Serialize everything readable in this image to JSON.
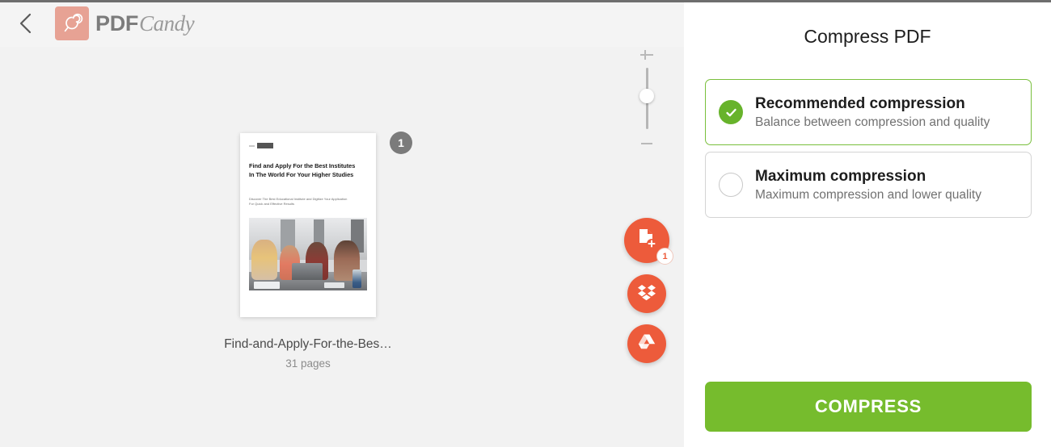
{
  "header": {
    "back_icon": "chevron-left-icon",
    "logo_icon": "lollipop-icon",
    "brand_primary": "PDF",
    "brand_secondary": "Candy",
    "brand_color": "#e7a294"
  },
  "viewer": {
    "page_badge": "1",
    "file_name": "Find-and-Apply-For-the-Bes…",
    "page_count": "31 pages",
    "document_preview": {
      "heading": "Find and Apply For the Best Institutes In The World For Your Higher Studies",
      "subheading": "Discover The Best Educational Institute and Digitize Your Application For Quick and Effective Results"
    },
    "zoom": {
      "increase_icon": "plus-icon",
      "decrease_icon": "minus-icon",
      "handle_icon": "slider-handle"
    },
    "actions": [
      {
        "name": "add-file",
        "icon": "document-plus-icon",
        "badge": "1",
        "color": "#ed5b3b"
      },
      {
        "name": "dropbox",
        "icon": "dropbox-icon",
        "badge": "",
        "color": "#ed5b3b"
      },
      {
        "name": "google-drive",
        "icon": "google-drive-icon",
        "badge": "",
        "color": "#ed5b3b"
      }
    ]
  },
  "sidebar": {
    "title": "Compress PDF",
    "options": [
      {
        "title": "Recommended compression",
        "description": "Balance between compression and quality",
        "selected": true,
        "accent": "#67b32b"
      },
      {
        "title": "Maximum compression",
        "description": "Maximum compression and lower quality",
        "selected": false,
        "accent": "#c8c8c8"
      }
    ],
    "submit_label": "COMPRESS",
    "submit_color": "#76bc2d"
  }
}
